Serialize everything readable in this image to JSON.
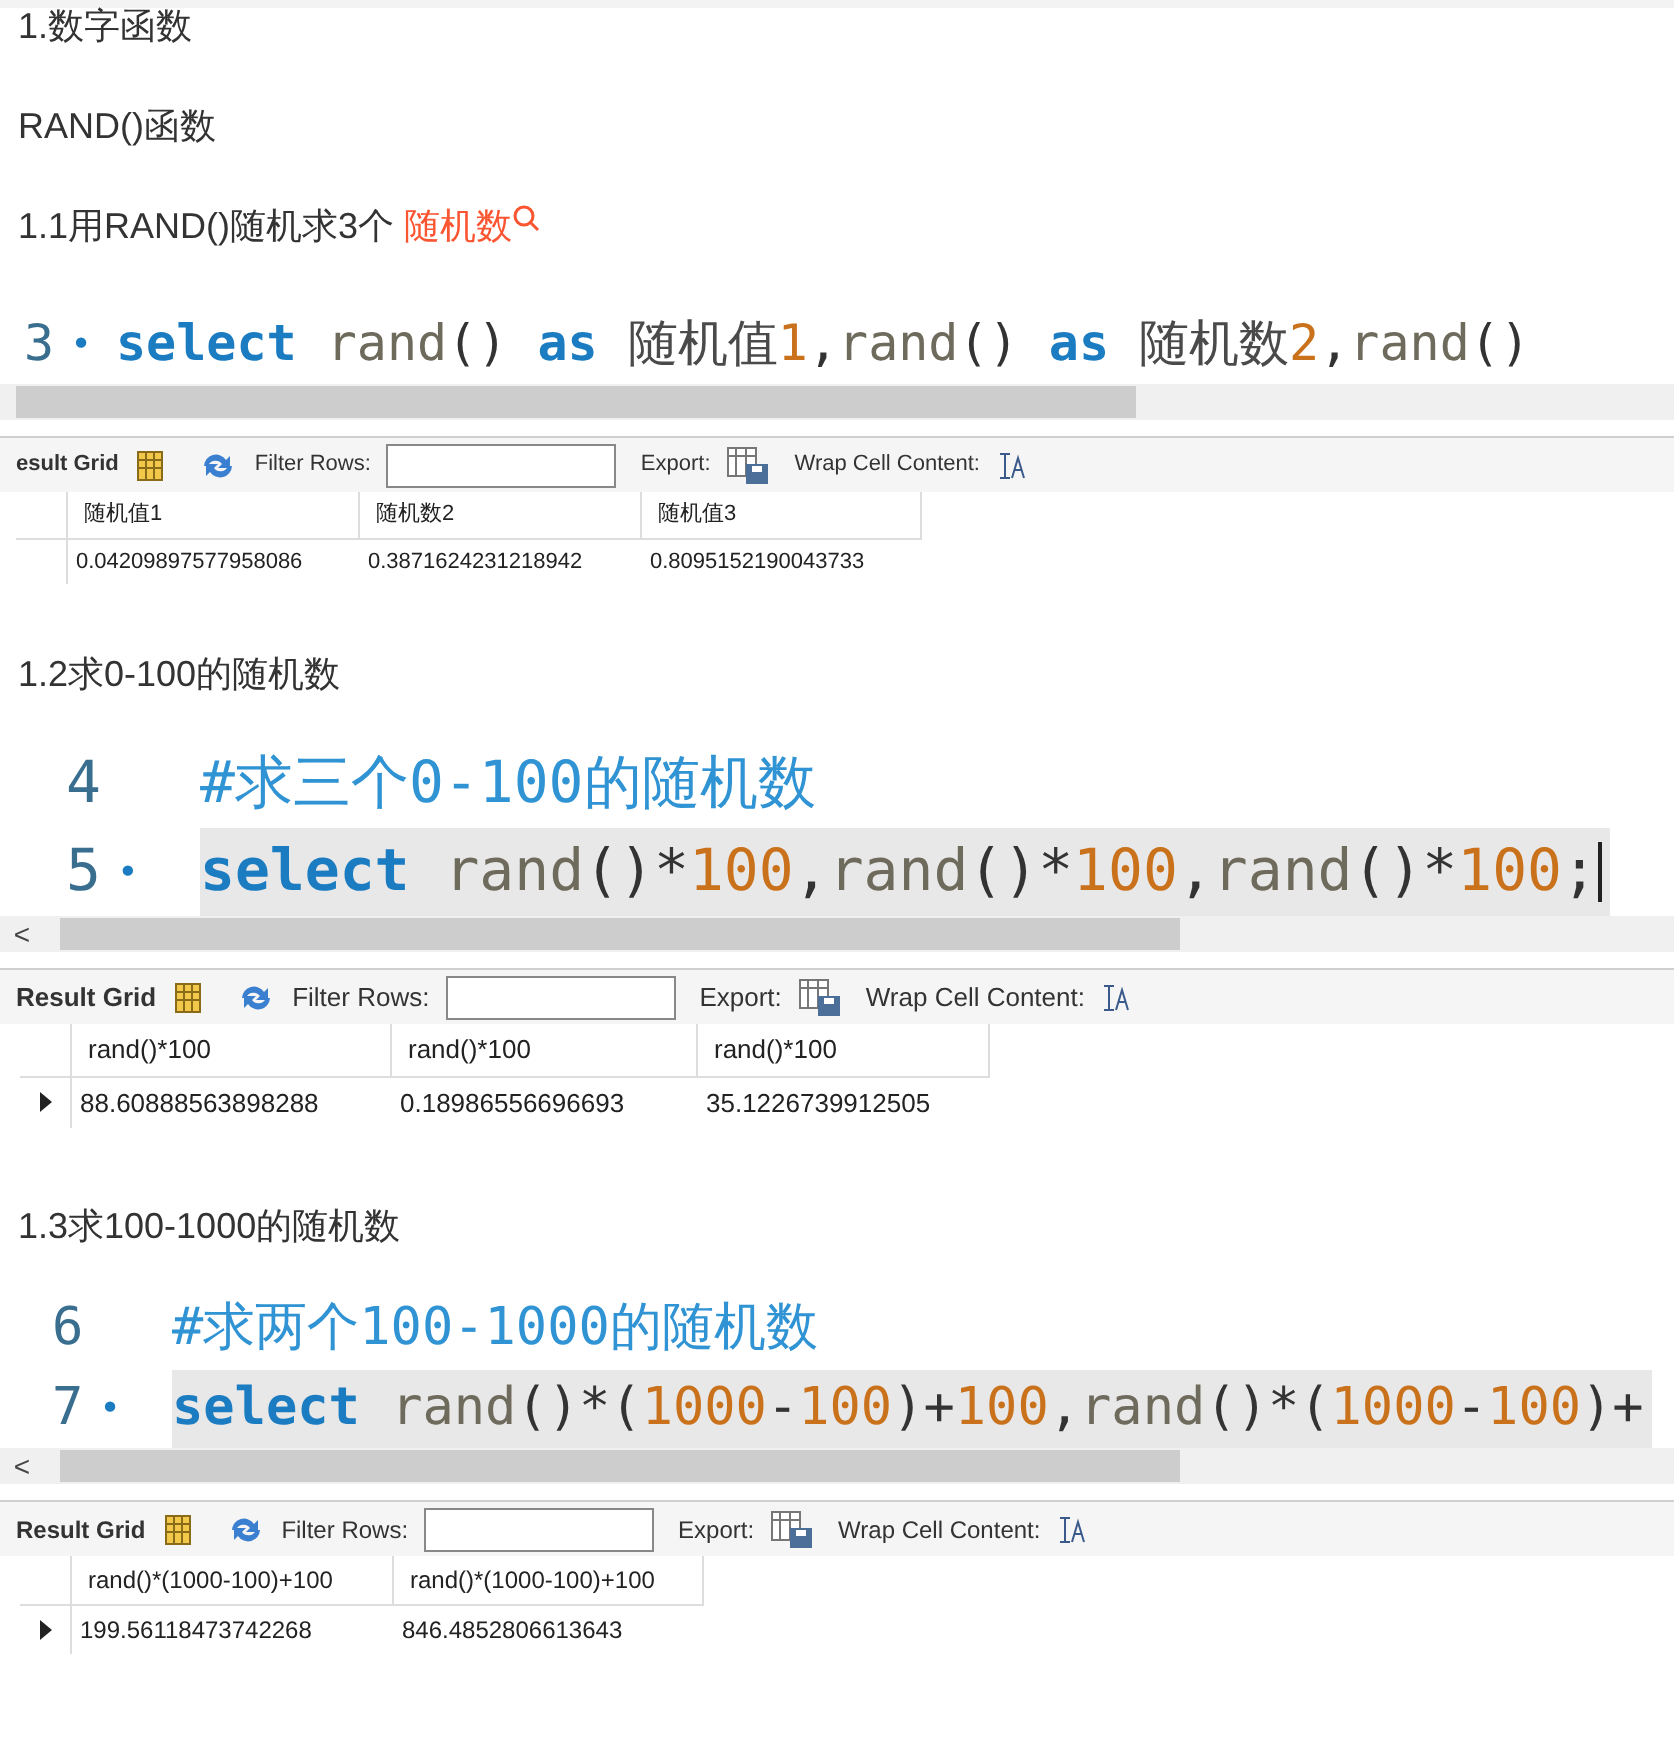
{
  "blocks": [
    {
      "kind": "text",
      "text": "1.数字函数"
    },
    {
      "kind": "text",
      "text": "RAND()函数"
    },
    {
      "kind": "text",
      "text": "1.1用RAND()随机求3个 ",
      "link": "随机数"
    },
    {
      "kind": "screenshot",
      "code_lines": [
        {
          "number": "3",
          "marker": "•",
          "current": false,
          "cursor": false,
          "tokens": [
            {
              "t": "select ",
              "kind": "keyword"
            },
            {
              "t": "rand",
              "kind": "func"
            },
            {
              "t": "() ",
              "kind": "paren"
            },
            {
              "t": "as ",
              "kind": "keyword"
            },
            {
              "t": "随机值",
              "kind": "ident"
            },
            {
              "t": "1",
              "kind": "number"
            },
            {
              "t": ",",
              "kind": "paren"
            },
            {
              "t": "rand",
              "kind": "func"
            },
            {
              "t": "() ",
              "kind": "paren"
            },
            {
              "t": "as ",
              "kind": "keyword"
            },
            {
              "t": "随机数",
              "kind": "ident"
            },
            {
              "t": "2",
              "kind": "number"
            },
            {
              "t": ",",
              "kind": "paren"
            },
            {
              "t": "rand",
              "kind": "func"
            },
            {
              "t": "() ",
              "kind": "paren"
            }
          ]
        }
      ],
      "toolbar": {
        "result_grid": "esult Grid",
        "filter_label": "Filter Rows:",
        "export_label": "Export:",
        "wrap_label": "Wrap Cell Content:"
      },
      "columns": [
        "随机值1",
        "随机数2",
        "随机值3"
      ],
      "rows": [
        {
          "current": false,
          "cells": [
            "0.04209897577958086",
            "0.3871624231218942",
            "0.8095152190043733"
          ]
        }
      ]
    },
    {
      "kind": "text",
      "text": "1.2求0-100的随机数"
    },
    {
      "kind": "screenshot",
      "scroll_left": "<",
      "code_lines": [
        {
          "number": "4",
          "current": false,
          "cursor": false,
          "tokens": [
            {
              "t": "#求三个0-100的随机数",
              "kind": "comment"
            }
          ]
        },
        {
          "number": "5",
          "marker": "•",
          "current": true,
          "cursor": true,
          "tokens": [
            {
              "t": "select ",
              "kind": "keyword"
            },
            {
              "t": "rand",
              "kind": "func"
            },
            {
              "t": "()",
              "kind": "paren"
            },
            {
              "t": "*",
              "kind": "paren"
            },
            {
              "t": "100",
              "kind": "number"
            },
            {
              "t": ",",
              "kind": "paren"
            },
            {
              "t": "rand",
              "kind": "func"
            },
            {
              "t": "()",
              "kind": "paren"
            },
            {
              "t": "*",
              "kind": "paren"
            },
            {
              "t": "100",
              "kind": "number"
            },
            {
              "t": ",",
              "kind": "paren"
            },
            {
              "t": "rand",
              "kind": "func"
            },
            {
              "t": "()",
              "kind": "paren"
            },
            {
              "t": "*",
              "kind": "paren"
            },
            {
              "t": "100",
              "kind": "number"
            },
            {
              "t": ";",
              "kind": "paren"
            }
          ]
        }
      ],
      "toolbar": {
        "result_grid": "Result Grid",
        "filter_label": "Filter Rows:",
        "export_label": "Export:",
        "wrap_label": "Wrap Cell Content:"
      },
      "columns": [
        "rand()*100",
        "rand()*100",
        "rand()*100"
      ],
      "rows": [
        {
          "current": true,
          "cells": [
            "88.60888563898288",
            "0.18986556696693",
            "35.1226739912505"
          ]
        }
      ]
    },
    {
      "kind": "text",
      "text": "1.3求100-1000的随机数"
    },
    {
      "kind": "screenshot",
      "scroll_left": "<",
      "code_lines": [
        {
          "number": "6",
          "current": false,
          "cursor": false,
          "tokens": [
            {
              "t": "#求两个100-1000的随机数",
              "kind": "comment"
            }
          ]
        },
        {
          "number": "7",
          "marker": "•",
          "current": true,
          "cursor": false,
          "tokens": [
            {
              "t": "select ",
              "kind": "keyword"
            },
            {
              "t": "rand",
              "kind": "func"
            },
            {
              "t": "()*(",
              "kind": "paren"
            },
            {
              "t": "1000",
              "kind": "number"
            },
            {
              "t": "-",
              "kind": "paren"
            },
            {
              "t": "100",
              "kind": "number"
            },
            {
              "t": ")+",
              "kind": "paren"
            },
            {
              "t": "100",
              "kind": "number"
            },
            {
              "t": ",",
              "kind": "paren"
            },
            {
              "t": "rand",
              "kind": "func"
            },
            {
              "t": "()*(",
              "kind": "paren"
            },
            {
              "t": "1000",
              "kind": "number"
            },
            {
              "t": "-",
              "kind": "paren"
            },
            {
              "t": "100",
              "kind": "number"
            },
            {
              "t": ")+",
              "kind": "paren"
            }
          ]
        }
      ],
      "toolbar": {
        "result_grid": "Result Grid",
        "filter_label": "Filter Rows:",
        "export_label": "Export:",
        "wrap_label": "Wrap Cell Content:"
      },
      "columns": [
        "rand()*(1000-100)+100",
        "rand()*(1000-100)+100"
      ],
      "rows": [
        {
          "current": true,
          "cells": [
            "199.56118473742268",
            "846.4852806613643"
          ]
        }
      ]
    }
  ]
}
